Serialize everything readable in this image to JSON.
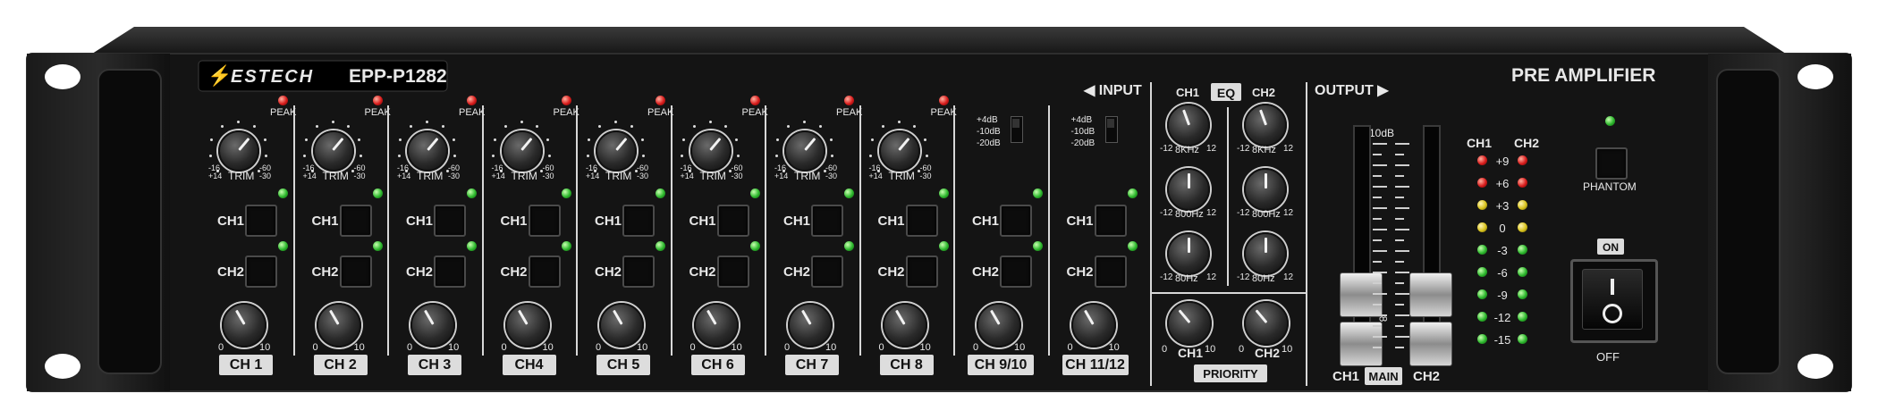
{
  "device": {
    "brand": "ESTECH",
    "model": "EPP-P1282",
    "title": "PRE AMPLIFIER"
  },
  "channel_strips": [
    {
      "label": "CH 1",
      "peak": "PEAK",
      "trim": "TRIM",
      "trim_left": "-16\n+14",
      "trim_right": "-60\n-30",
      "bus1": "CH1",
      "bus2": "CH2"
    },
    {
      "label": "CH 2",
      "peak": "PEAK",
      "trim": "TRIM",
      "trim_left": "-16\n+14",
      "trim_right": "-60\n-30",
      "bus1": "CH1",
      "bus2": "CH2"
    },
    {
      "label": "CH 3",
      "peak": "PEAK",
      "trim": "TRIM",
      "trim_left": "-16\n+14",
      "trim_right": "-60\n-30",
      "bus1": "CH1",
      "bus2": "CH2"
    },
    {
      "label": "CH4",
      "peak": "PEAK",
      "trim": "TRIM",
      "trim_left": "-16\n+14",
      "trim_right": "-60\n-30",
      "bus1": "CH1",
      "bus2": "CH2"
    },
    {
      "label": "CH 5",
      "peak": "PEAK",
      "trim": "TRIM",
      "trim_left": "-16\n+14",
      "trim_right": "-60\n-30",
      "bus1": "CH1",
      "bus2": "CH2"
    },
    {
      "label": "CH 6",
      "peak": "PEAK",
      "trim": "TRIM",
      "trim_left": "-16\n+14",
      "trim_right": "-60\n-30",
      "bus1": "CH1",
      "bus2": "CH2"
    },
    {
      "label": "CH 7",
      "peak": "PEAK",
      "trim": "TRIM",
      "trim_left": "-16\n+14",
      "trim_right": "-60\n-30",
      "bus1": "CH1",
      "bus2": "CH2"
    },
    {
      "label": "CH 8",
      "peak": "PEAK",
      "trim": "TRIM",
      "trim_left": "-16\n+14",
      "trim_right": "-60\n-30",
      "bus1": "CH1",
      "bus2": "CH2"
    }
  ],
  "stereo_strips": [
    {
      "label": "CH 9/10",
      "sens_options": [
        "+4dB",
        "-10dB",
        "-20dB"
      ],
      "bus1": "CH1",
      "bus2": "CH2"
    },
    {
      "label": "CH 11/12",
      "sens_options": [
        "+4dB",
        "-10dB",
        "-20dB"
      ],
      "bus1": "CH1",
      "bus2": "CH2"
    }
  ],
  "level_scale": {
    "min": "0",
    "max": "10"
  },
  "input_label": "◀ INPUT",
  "eq": {
    "title": "EQ",
    "col1": "CH1",
    "col2": "CH2",
    "bands": [
      {
        "freq": "8KHz",
        "min": "-12",
        "max": "12"
      },
      {
        "freq": "800Hz",
        "min": "-12",
        "max": "12"
      },
      {
        "freq": "80Hz",
        "min": "-12",
        "max": "12"
      }
    ]
  },
  "priority": {
    "title": "PRIORITY",
    "ch1": "CH1",
    "ch2": "CH2",
    "min": "0",
    "max": "10"
  },
  "output": {
    "title": "OUTPUT ▶",
    "scale_top": "10dB",
    "scale_mid": "8",
    "fader1": "CH1",
    "fader2": "CH2",
    "main": "MAIN"
  },
  "meter": {
    "col1": "CH1",
    "col2": "CH2",
    "levels": [
      "+9",
      "+6",
      "+3",
      "0",
      "-3",
      "-6",
      "-9",
      "-12",
      "-15"
    ]
  },
  "phantom": {
    "label": "PHANTOM"
  },
  "power": {
    "on": "ON",
    "off": "OFF"
  },
  "colors": {
    "panel": "#141414",
    "text": "#e8e8e8",
    "label_box": "#dddddd",
    "led_green": "#2db82d",
    "led_red": "#d81c1c",
    "led_yellow": "#d8c21c"
  }
}
